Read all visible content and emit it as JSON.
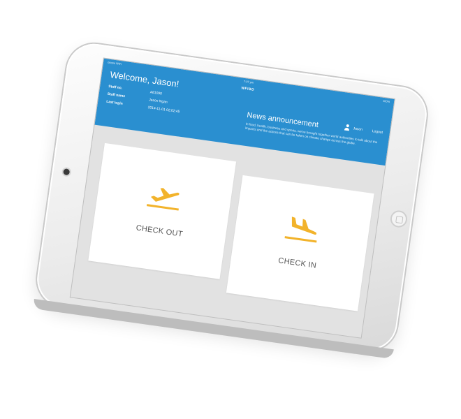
{
  "status_bar": {
    "carrier": "ooooo WiFi",
    "time": "7:07 pm",
    "battery": "100%"
  },
  "header": {
    "brand": "WFIBD",
    "welcome": "Welcome, Jason!",
    "info": [
      {
        "label": "Staff no.",
        "value": "A81090"
      },
      {
        "label": "Staff name",
        "value": "Jason Ngan"
      },
      {
        "label": "Last login",
        "value": "2014-11-01 02:02:45"
      }
    ],
    "user_name": "Jason",
    "logout_label": "Logout"
  },
  "news": {
    "title": "News announcement",
    "body": "In food, health, business and sports, we've brought together world authorities to talk about the impacts and the actions that can be taken on climate change across the globe."
  },
  "actions": {
    "check_out_label": "CHECK OUT",
    "check_in_label": "CHECK IN",
    "icon_color": "#f2b32b"
  },
  "colors": {
    "header": "#2a8fd0",
    "panel": "#e2e2e2",
    "card": "#ffffff"
  }
}
